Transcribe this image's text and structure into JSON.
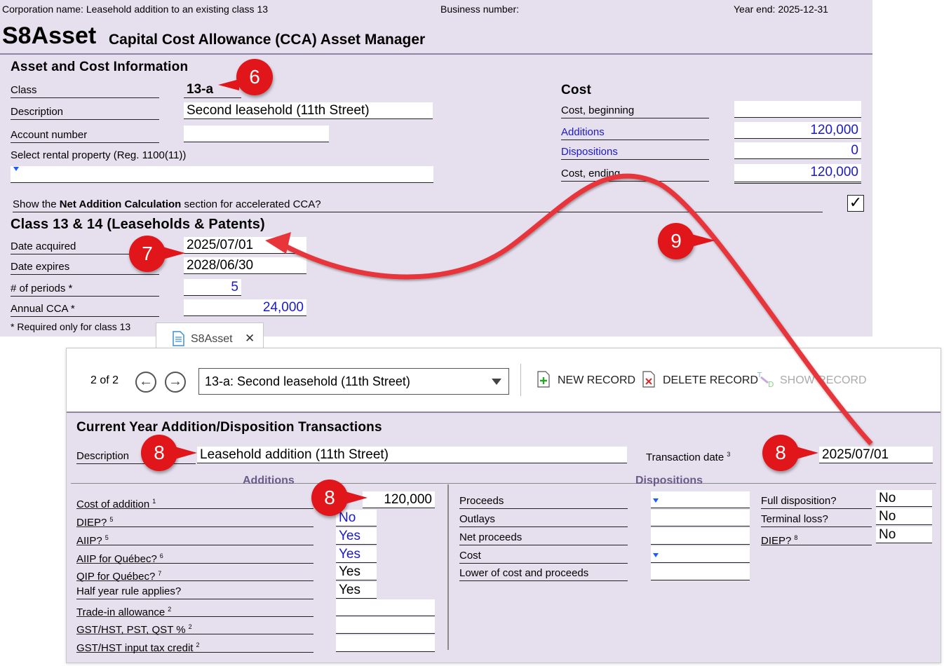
{
  "header": {
    "corporation": "Corporation name: Leasehold addition to an existing class 13",
    "business_number": "Business number:",
    "year_end": "Year end: 2025-12-31"
  },
  "title": {
    "code": "S8Asset",
    "subtitle": "Capital Cost Allowance (CCA) Asset Manager"
  },
  "asset": {
    "section": "Asset and Cost Information",
    "class_label": "Class",
    "class_value": "13-a",
    "description_label": "Description",
    "description_value": "Second leasehold (11th Street)",
    "account_label": "Account number",
    "account_value": "",
    "rental_label": "Select rental property (Reg. 1100(11))",
    "rental_value": ""
  },
  "cost": {
    "section": "Cost",
    "beginning_label": "Cost, beginning",
    "beginning_value": "",
    "additions_label": "Additions",
    "additions_value": "120,000",
    "dispositions_label": "Dispositions",
    "dispositions_value": "0",
    "ending_label": "Cost, ending",
    "ending_value": "120,000"
  },
  "net_addition": {
    "prefix": "Show the ",
    "bold": "Net Addition Calculation",
    "suffix": " section for accelerated CCA?",
    "checked": "✓"
  },
  "class13": {
    "section": "Class 13 & 14 (Leaseholds & Patents)",
    "date_acquired_label": "Date acquired",
    "date_acquired_value": "2025/07/01",
    "date_expires_label": "Date expires",
    "date_expires_value": "2028/06/30",
    "periods_label": "# of periods *",
    "periods_value": "5",
    "annual_label": "Annual CCA *",
    "annual_value": "24,000",
    "note": "* Required only for class 13"
  },
  "tab": {
    "label": "S8Asset",
    "close": "✕"
  },
  "toolbar": {
    "record_counter": "2 of 2",
    "record_select": "13-a: Second leasehold (11th Street)",
    "new_record": "NEW RECORD",
    "delete_record": "DELETE RECORD",
    "show_record": "SHOW RECORD"
  },
  "transactions": {
    "section": "Current Year Addition/Disposition Transactions",
    "description_label": "Description",
    "description_value": "Leasehold addition (11th Street)",
    "date_label": "Transaction date",
    "date_sup": "3",
    "date_value": "2025/07/01",
    "additions_head": "Additions",
    "dispositions_head": "Dispositions",
    "additions": [
      {
        "label": "Cost of addition",
        "sup": "1",
        "value": "120,000"
      },
      {
        "label": "DIEP?",
        "sup": "5",
        "value": "No"
      },
      {
        "label": "AIIP?",
        "sup": "5",
        "value": "Yes"
      },
      {
        "label": "AIIP for Québec?",
        "sup": "6",
        "value": "Yes"
      },
      {
        "label": "QIP for Québec?",
        "sup": "7",
        "value": "Yes"
      },
      {
        "label": "Half year rule applies?",
        "sup": "",
        "value": "Yes"
      },
      {
        "label": "Trade-in allowance",
        "sup": "2",
        "value": ""
      },
      {
        "label": "GST/HST, PST, QST %",
        "sup": "2",
        "value": ""
      },
      {
        "label": "GST/HST input tax credit",
        "sup": "2",
        "value": ""
      }
    ],
    "dispositions": [
      {
        "label": "Proceeds",
        "value": ""
      },
      {
        "label": "Outlays",
        "value": ""
      },
      {
        "label": "Net proceeds",
        "value": ""
      },
      {
        "label": "Cost",
        "value": ""
      },
      {
        "label": "Lower of cost and proceeds",
        "value": ""
      }
    ],
    "flags": [
      {
        "label": "Full disposition?",
        "sup": "",
        "value": "No"
      },
      {
        "label": "Terminal loss?",
        "sup": "",
        "value": "No"
      },
      {
        "label": "DIEP?",
        "sup": "8",
        "value": "No"
      }
    ]
  },
  "callouts": {
    "c6": "6",
    "c7": "7",
    "c8a": "8",
    "c8b": "8",
    "c8c": "8",
    "c9": "9"
  },
  "colors": {
    "panel": "#e6e0ee",
    "callout": "#e0161a",
    "link": "#1a1acc"
  }
}
